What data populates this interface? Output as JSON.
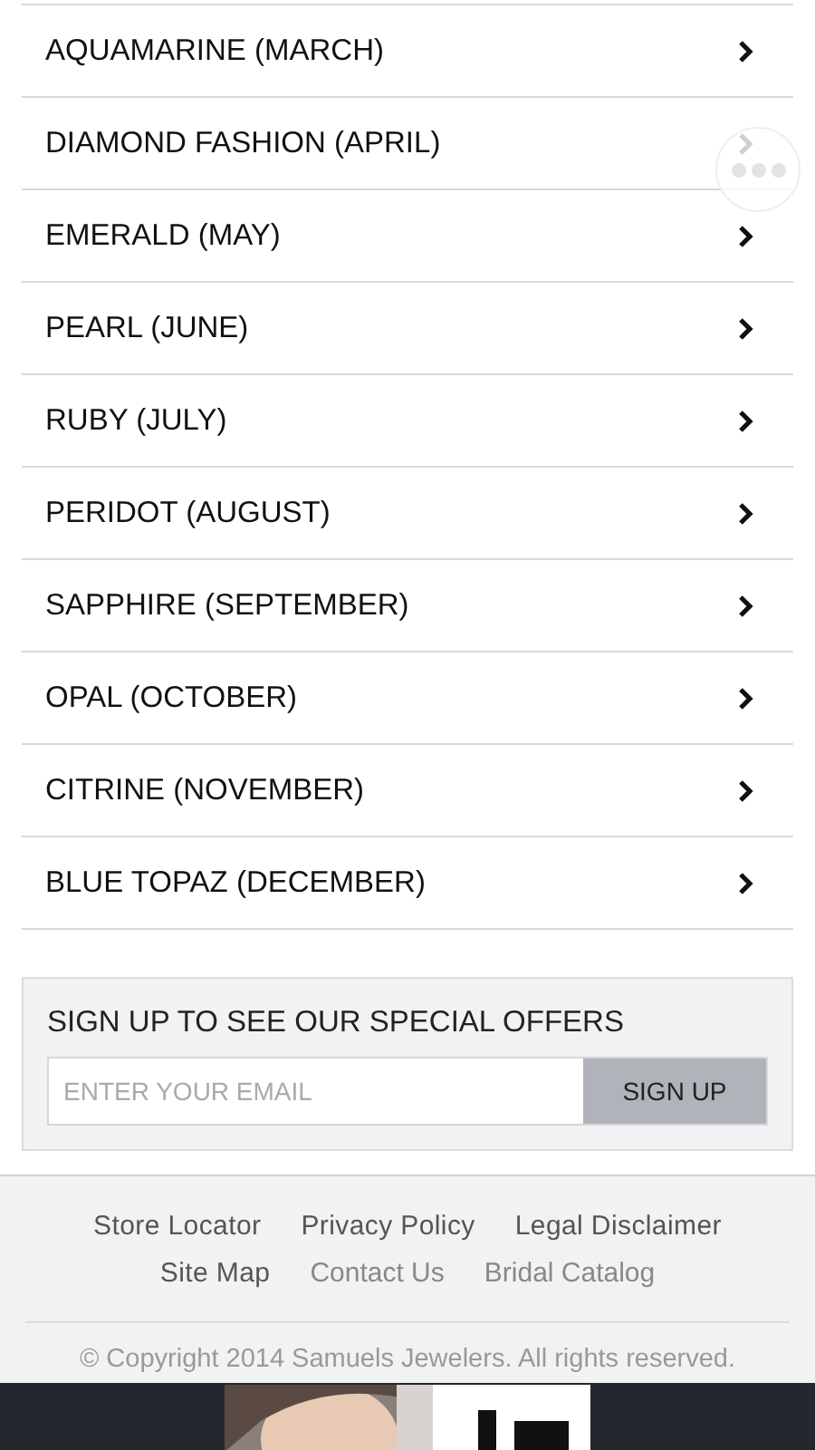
{
  "birthstones": [
    {
      "label": "AQUAMARINE (MARCH)"
    },
    {
      "label": "DIAMOND FASHION (APRIL)"
    },
    {
      "label": "EMERALD (MAY)"
    },
    {
      "label": "PEARL (JUNE)"
    },
    {
      "label": "RUBY (JULY)"
    },
    {
      "label": "PERIDOT (AUGUST)"
    },
    {
      "label": "SAPPHIRE (SEPTEMBER)"
    },
    {
      "label": "OPAL (OCTOBER)"
    },
    {
      "label": "CITRINE (NOVEMBER)"
    },
    {
      "label": "BLUE TOPAZ (DECEMBER)"
    }
  ],
  "signup": {
    "title": "SIGN UP TO SEE OUR SPECIAL OFFERS",
    "email": {
      "placeholder": "ENTER YOUR EMAIL"
    },
    "button": "SIGN UP"
  },
  "footer": {
    "link_rows": [
      [
        {
          "label": "Store Locator",
          "bold": true
        },
        {
          "label": "Privacy Policy",
          "bold": true
        },
        {
          "label": "Legal Disclaimer",
          "bold": true
        }
      ],
      [
        {
          "label": "Site Map",
          "bold": true
        },
        {
          "label": "Contact Us",
          "bold": false
        },
        {
          "label": "Bridal Catalog",
          "bold": false
        }
      ]
    ],
    "copyright": "© Copyright 2014 Samuels Jewelers. All rights reserved."
  }
}
